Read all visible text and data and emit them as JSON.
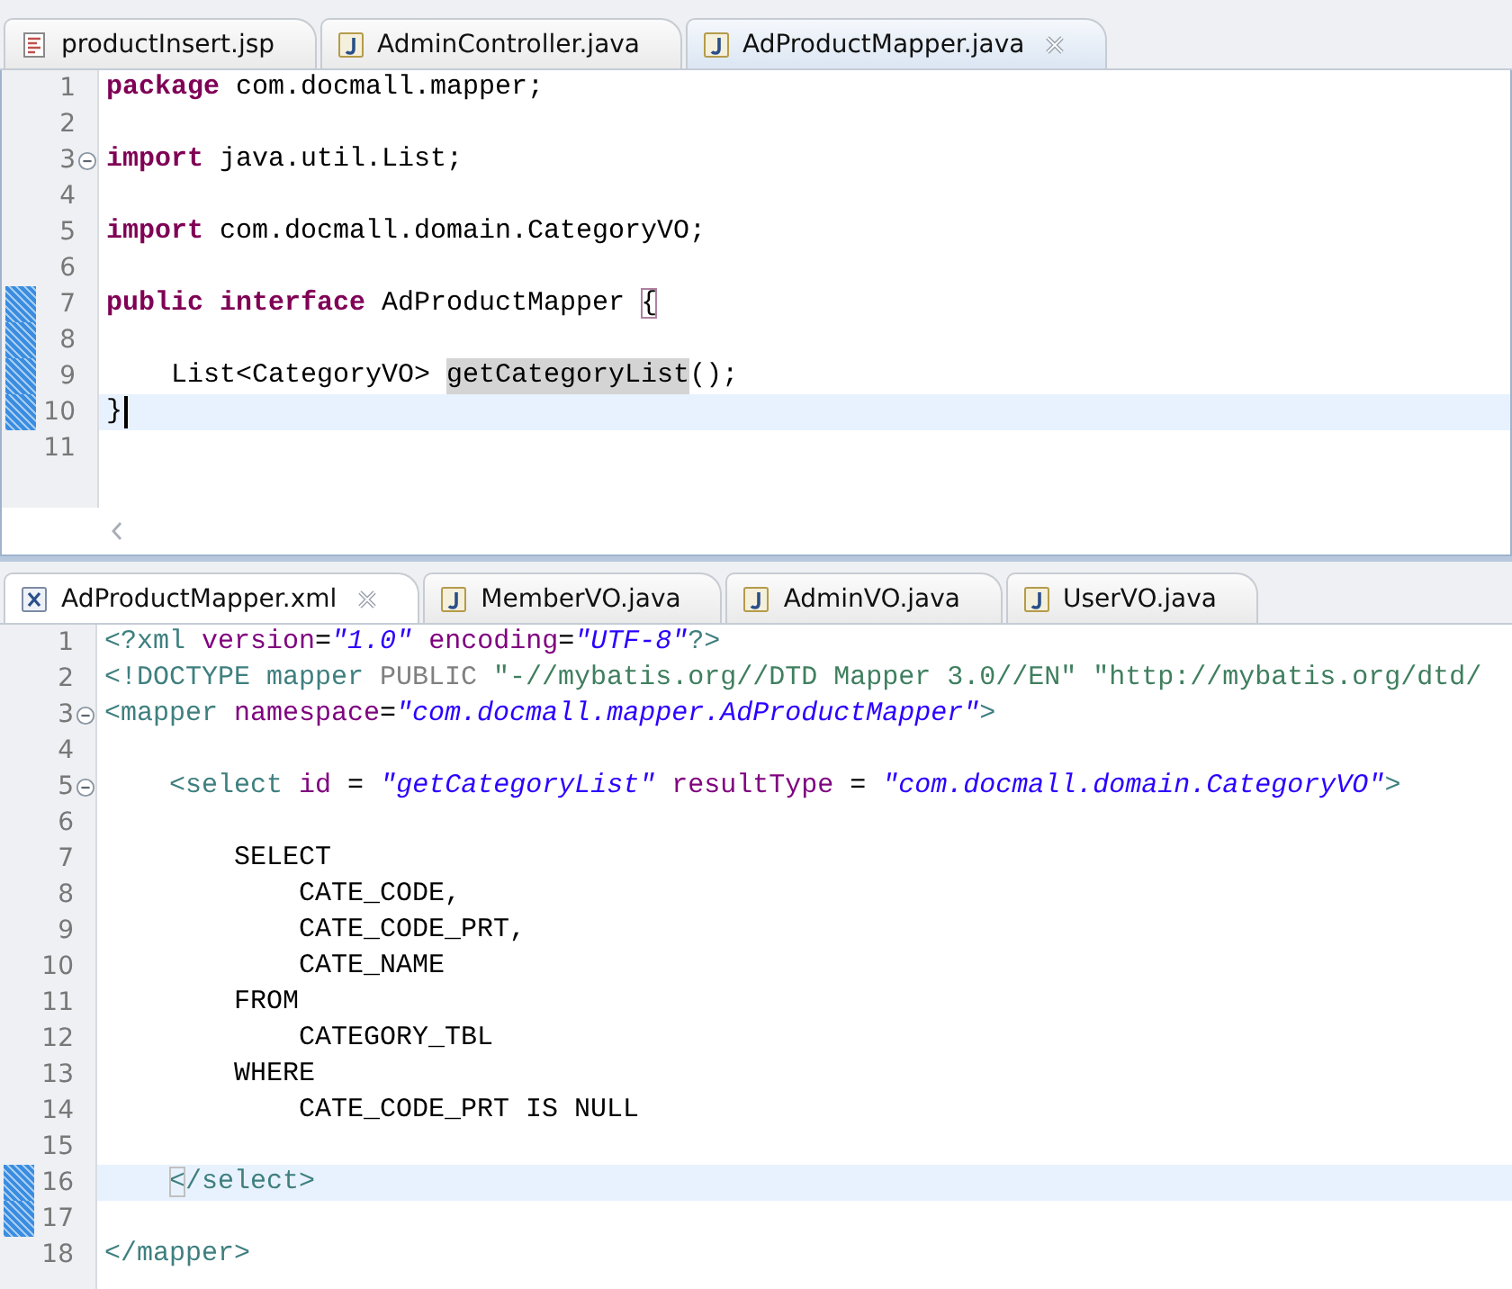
{
  "editors": [
    {
      "focused": true,
      "tabs": [
        {
          "label": "productInsert.jsp",
          "kind": "jsp",
          "selected": false
        },
        {
          "label": "AdminController.java",
          "kind": "java",
          "selected": false
        },
        {
          "label": "AdProductMapper.java",
          "kind": "java",
          "selected": true
        }
      ],
      "lines": [
        {
          "number": "1",
          "tokens": [
            {
              "text": "package",
              "kind": "keyword"
            },
            {
              "text": " com.docmall.mapper;",
              "kind": "plain"
            }
          ]
        },
        {
          "number": "2"
        },
        {
          "number": "3",
          "fold": true,
          "tokens": [
            {
              "text": "import",
              "kind": "keyword"
            },
            {
              "text": " java.util.List;",
              "kind": "plain"
            }
          ]
        },
        {
          "number": "4"
        },
        {
          "number": "5",
          "tokens": [
            {
              "text": "import",
              "kind": "keyword"
            },
            {
              "text": " com.docmall.domain.CategoryVO;",
              "kind": "plain"
            }
          ]
        },
        {
          "number": "6"
        },
        {
          "number": "7",
          "changed": true,
          "tokens": [
            {
              "text": "public",
              "kind": "keyword"
            },
            {
              "text": " interface",
              "kind": "keyword"
            },
            {
              "text": " AdProductMapper ",
              "kind": "plain"
            },
            {
              "text": "{",
              "kind": "plain",
              "matched": true
            }
          ]
        },
        {
          "number": "8",
          "changed": true
        },
        {
          "number": "9",
          "changed": true,
          "tokens": [
            {
              "text": "    List<CategoryVO> ",
              "kind": "plain"
            },
            {
              "text": "getCategoryList",
              "kind": "occurrence"
            },
            {
              "text": "();",
              "kind": "plain"
            }
          ]
        },
        {
          "number": "10",
          "changed": true,
          "current": true,
          "tokens": [
            {
              "text": "}",
              "kind": "plain"
            }
          ]
        },
        {
          "number": "11"
        }
      ]
    },
    {
      "focused": false,
      "tabs": [
        {
          "label": "AdProductMapper.xml",
          "kind": "xml",
          "selected": true
        },
        {
          "label": "MemberVO.java",
          "kind": "java",
          "selected": false
        },
        {
          "label": "AdminVO.java",
          "kind": "java",
          "selected": false
        },
        {
          "label": "UserVO.java",
          "kind": "java",
          "selected": false
        }
      ],
      "lines": [
        {
          "number": "1",
          "tokens": [
            {
              "text": "<?xml ",
              "kind": "tag"
            },
            {
              "text": "version",
              "kind": "attr"
            },
            {
              "text": "=",
              "kind": "plain"
            },
            {
              "text": "\"1.0\"",
              "kind": "value"
            },
            {
              "text": " encoding",
              "kind": "attr"
            },
            {
              "text": "=",
              "kind": "plain"
            },
            {
              "text": "\"UTF-8\"",
              "kind": "value"
            },
            {
              "text": "?>",
              "kind": "tag"
            }
          ]
        },
        {
          "number": "2",
          "tokens": [
            {
              "text": "<!DOCTYPE mapper ",
              "kind": "tag"
            },
            {
              "text": "PUBLIC",
              "kind": "muted"
            },
            {
              "text": " \"-//mybatis.org//DTD Mapper 3.0//EN\" \"http://mybatis.org/dtd/",
              "kind": "doctype"
            }
          ]
        },
        {
          "number": "3",
          "fold": true,
          "tokens": [
            {
              "text": "<mapper ",
              "kind": "tag"
            },
            {
              "text": "namespace",
              "kind": "attr"
            },
            {
              "text": "=",
              "kind": "plain"
            },
            {
              "text": "\"com.docmall.mapper.AdProductMapper\"",
              "kind": "value"
            },
            {
              "text": ">",
              "kind": "tag"
            }
          ]
        },
        {
          "number": "4"
        },
        {
          "number": "5",
          "fold": true,
          "tokens": [
            {
              "text": "    <select ",
              "kind": "tag"
            },
            {
              "text": "id",
              "kind": "attr"
            },
            {
              "text": " = ",
              "kind": "plain"
            },
            {
              "text": "\"getCategoryList\"",
              "kind": "value"
            },
            {
              "text": " resultType",
              "kind": "attr"
            },
            {
              "text": " = ",
              "kind": "plain"
            },
            {
              "text": "\"com.docmall.domain.CategoryVO\"",
              "kind": "value"
            },
            {
              "text": ">",
              "kind": "tag"
            }
          ]
        },
        {
          "number": "6"
        },
        {
          "number": "7",
          "tokens": [
            {
              "text": "        SELECT",
              "kind": "plain"
            }
          ]
        },
        {
          "number": "8",
          "tokens": [
            {
              "text": "            CATE_CODE,",
              "kind": "plain"
            }
          ]
        },
        {
          "number": "9",
          "tokens": [
            {
              "text": "            CATE_CODE_PRT,",
              "kind": "plain"
            }
          ]
        },
        {
          "number": "10",
          "tokens": [
            {
              "text": "            CATE_NAME",
              "kind": "plain"
            }
          ]
        },
        {
          "number": "11",
          "tokens": [
            {
              "text": "        FROM",
              "kind": "plain"
            }
          ]
        },
        {
          "number": "12",
          "tokens": [
            {
              "text": "            CATEGORY_TBL",
              "kind": "plain"
            }
          ]
        },
        {
          "number": "13",
          "tokens": [
            {
              "text": "        WHERE",
              "kind": "plain"
            }
          ]
        },
        {
          "number": "14",
          "tokens": [
            {
              "text": "            CATE_CODE_PRT IS NULL",
              "kind": "plain"
            }
          ]
        },
        {
          "number": "15"
        },
        {
          "number": "16",
          "changed": true,
          "current": true,
          "tokens": [
            {
              "text": "    </select>",
              "kind": "tag",
              "matched": true
            }
          ]
        },
        {
          "number": "17",
          "changed": true
        },
        {
          "number": "18",
          "tokens": [
            {
              "text": "</mapper>",
              "kind": "tag"
            }
          ]
        }
      ]
    }
  ]
}
